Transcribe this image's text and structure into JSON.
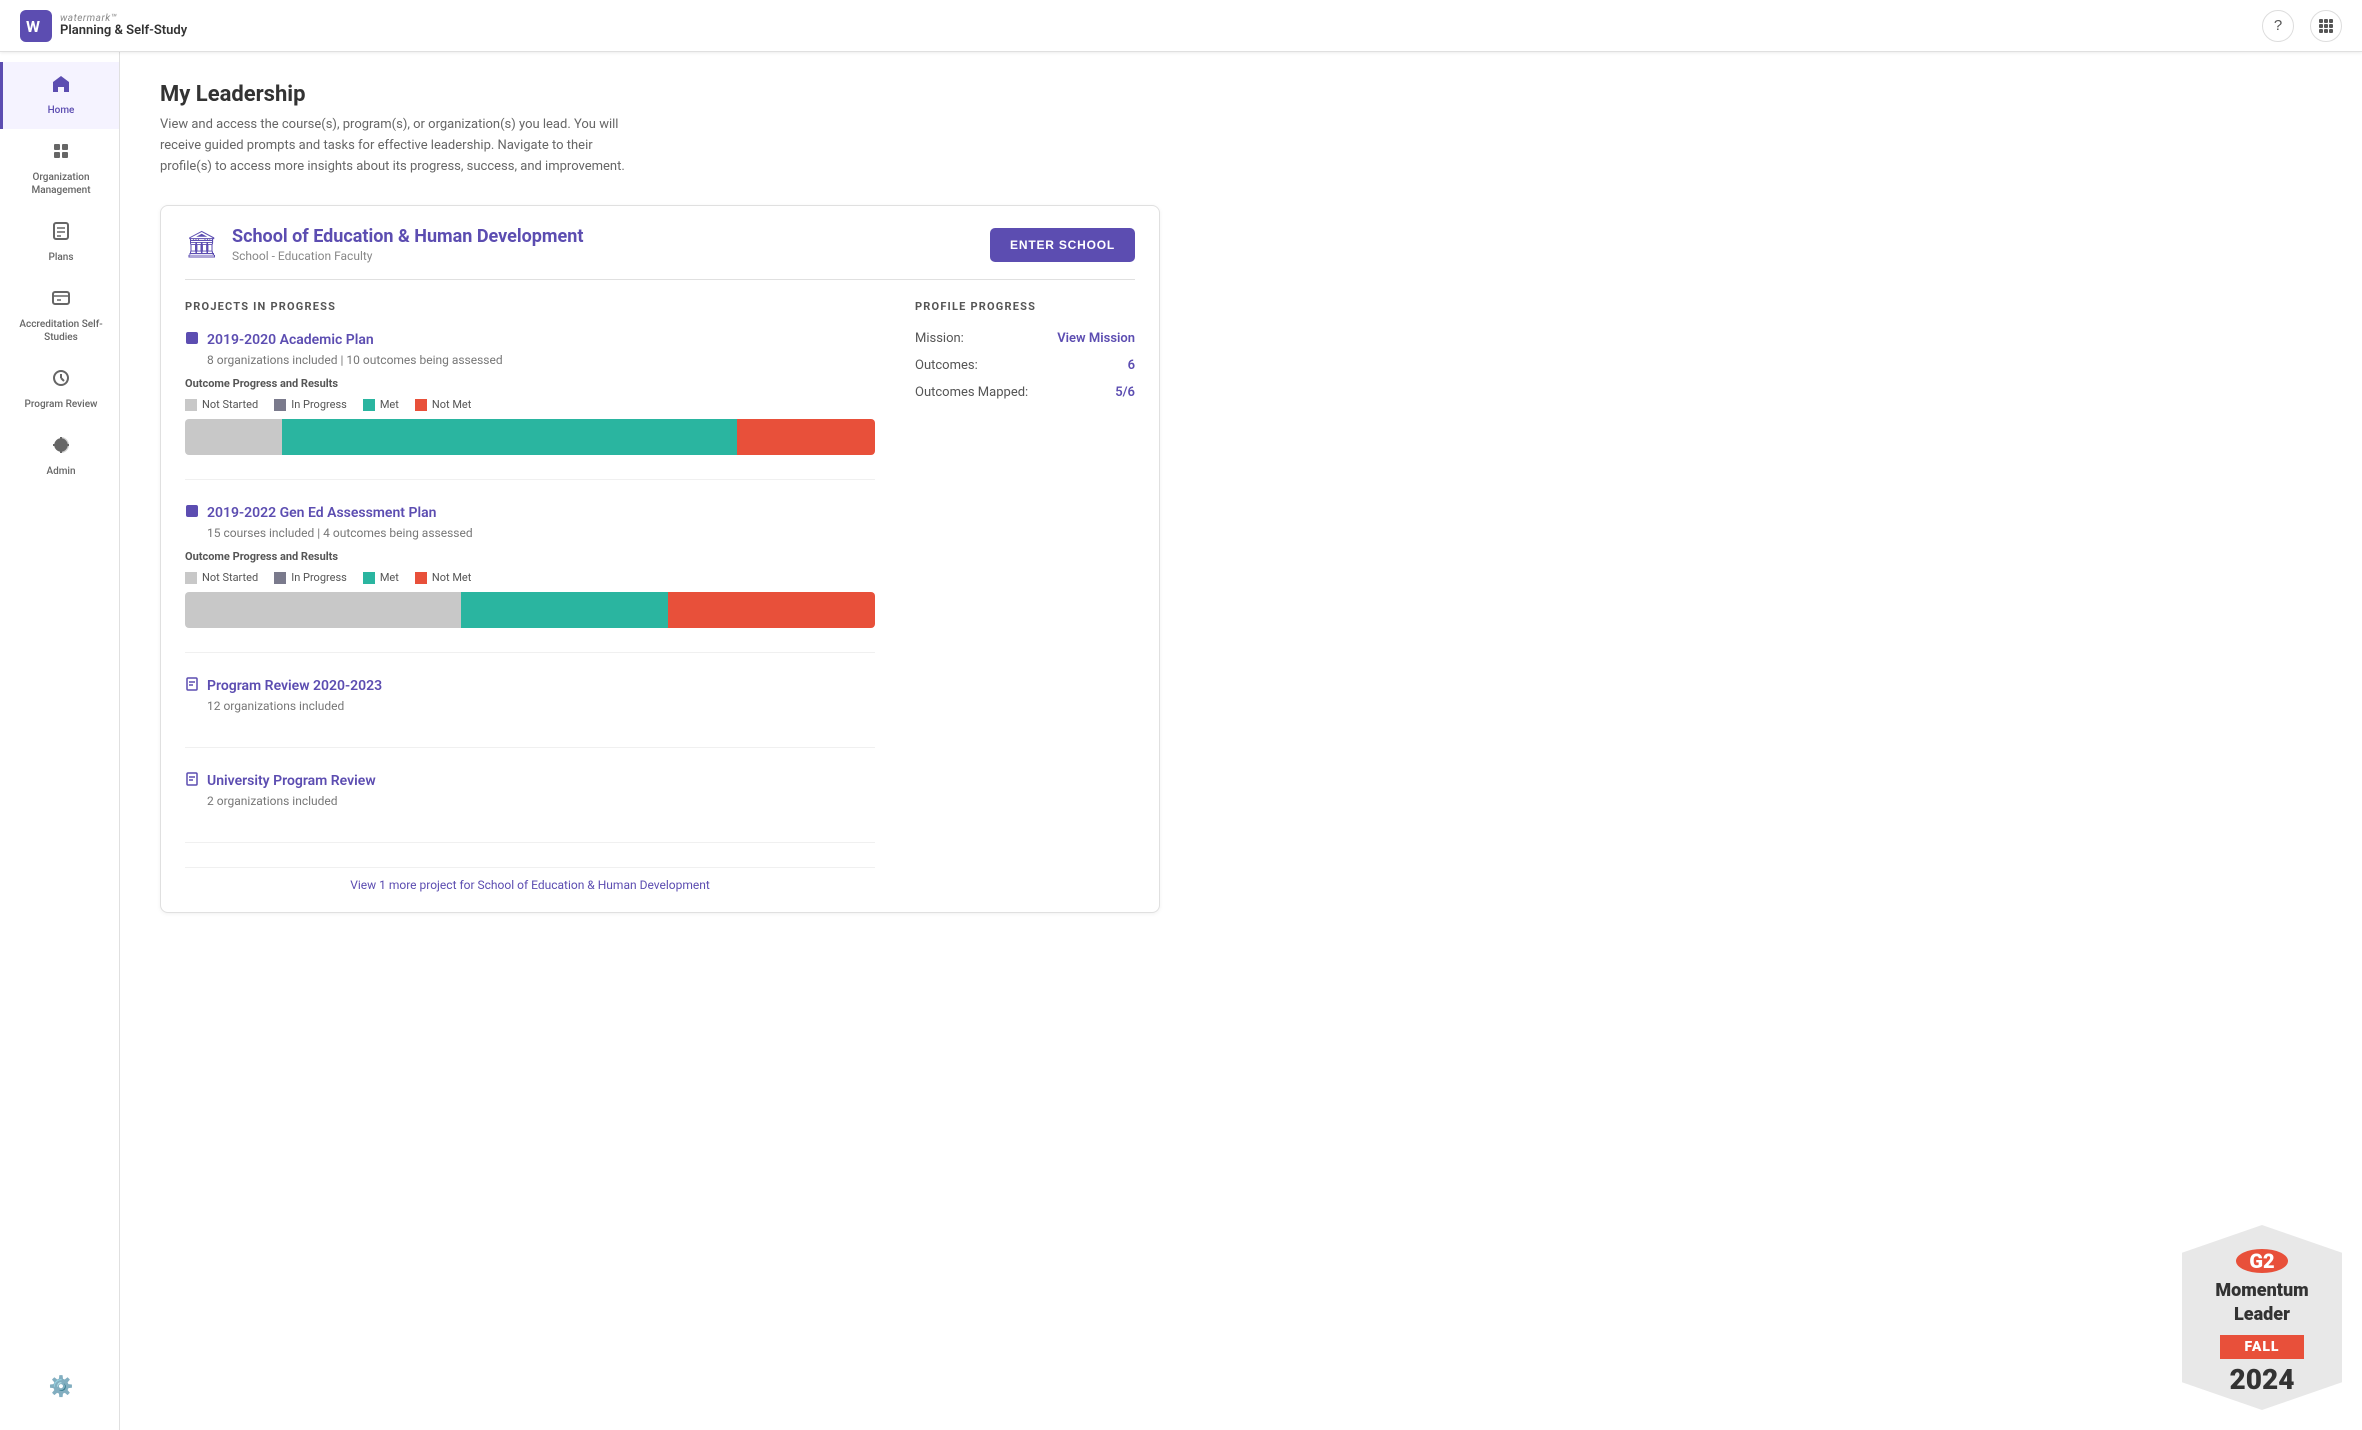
{
  "app": {
    "brand": "watermark™",
    "product": "Planning & Self-Study"
  },
  "nav_icons": {
    "help": "?",
    "grid": "⠿"
  },
  "sidebar": {
    "items": [
      {
        "id": "home",
        "label": "Home",
        "icon": "🏠",
        "active": true
      },
      {
        "id": "org-management",
        "label": "Organization Management",
        "icon": "🏢",
        "active": false
      },
      {
        "id": "plans",
        "label": "Plans",
        "icon": "📋",
        "active": false
      },
      {
        "id": "accreditation",
        "label": "Accreditation Self-Studies",
        "icon": "📁",
        "active": false
      },
      {
        "id": "program-review",
        "label": "Program Review",
        "icon": "⚙️",
        "active": false
      },
      {
        "id": "admin",
        "label": "Admin",
        "icon": "⚙️",
        "active": false
      }
    ],
    "bottom_icon": "⚙️"
  },
  "page": {
    "title": "My Leadership",
    "description": "View and access the course(s), program(s), or organization(s) you lead. You will receive guided prompts and tasks for effective leadership. Navigate to their profile(s) to access more insights about its progress, success, and improvement."
  },
  "school_card": {
    "icon": "🏛",
    "name": "School of Education & Human Development",
    "subtitle": "School - Education Faculty",
    "enter_button": "ENTER SCHOOL",
    "projects_title": "PROJECTS IN PROGRESS",
    "profile_title": "PROFILE PROGRESS",
    "projects": [
      {
        "id": "project-1",
        "icon": "📊",
        "title": "2019-2020 Academic Plan",
        "meta": "8 organizations included | 10 outcomes being assessed",
        "show_chart": true,
        "outcome_label": "Outcome Progress and Results",
        "legend": [
          {
            "key": "not-started",
            "label": "Not Started"
          },
          {
            "key": "in-progress",
            "label": "In Progress"
          },
          {
            "key": "met",
            "label": "Met"
          },
          {
            "key": "not-met",
            "label": "Not Met"
          }
        ],
        "bar": [
          {
            "key": "not-started",
            "pct": 14
          },
          {
            "key": "met",
            "pct": 66
          },
          {
            "key": "not-met",
            "pct": 20
          }
        ]
      },
      {
        "id": "project-2",
        "icon": "📊",
        "title": "2019-2022 Gen Ed Assessment Plan",
        "meta": "15 courses included | 4 outcomes being assessed",
        "show_chart": true,
        "outcome_label": "Outcome Progress and Results",
        "legend": [
          {
            "key": "not-started",
            "label": "Not Started"
          },
          {
            "key": "in-progress",
            "label": "In Progress"
          },
          {
            "key": "met",
            "label": "Met"
          },
          {
            "key": "not-met",
            "label": "Not Met"
          }
        ],
        "bar": [
          {
            "key": "not-started",
            "pct": 40
          },
          {
            "key": "met",
            "pct": 30
          },
          {
            "key": "not-met",
            "pct": 30
          }
        ]
      },
      {
        "id": "project-3",
        "icon": "📄",
        "title": "Program Review 2020-2023",
        "meta": "12 organizations included",
        "show_chart": false
      },
      {
        "id": "project-4",
        "icon": "📄",
        "title": "University Program Review",
        "meta": "2 organizations included",
        "show_chart": false
      }
    ],
    "view_more": "View 1 more project for School of Education & Human Development",
    "profile": {
      "rows": [
        {
          "label": "Mission:",
          "value": "View Mission",
          "link": true
        },
        {
          "label": "Outcomes:",
          "value": "6",
          "link": true
        },
        {
          "label": "Outcomes Mapped:",
          "value": "5/6",
          "link": true
        }
      ]
    }
  },
  "g2_badge": {
    "circle_text": "G2",
    "line1": "Momentum",
    "line2": "Leader",
    "season": "FALL",
    "year": "2024"
  }
}
